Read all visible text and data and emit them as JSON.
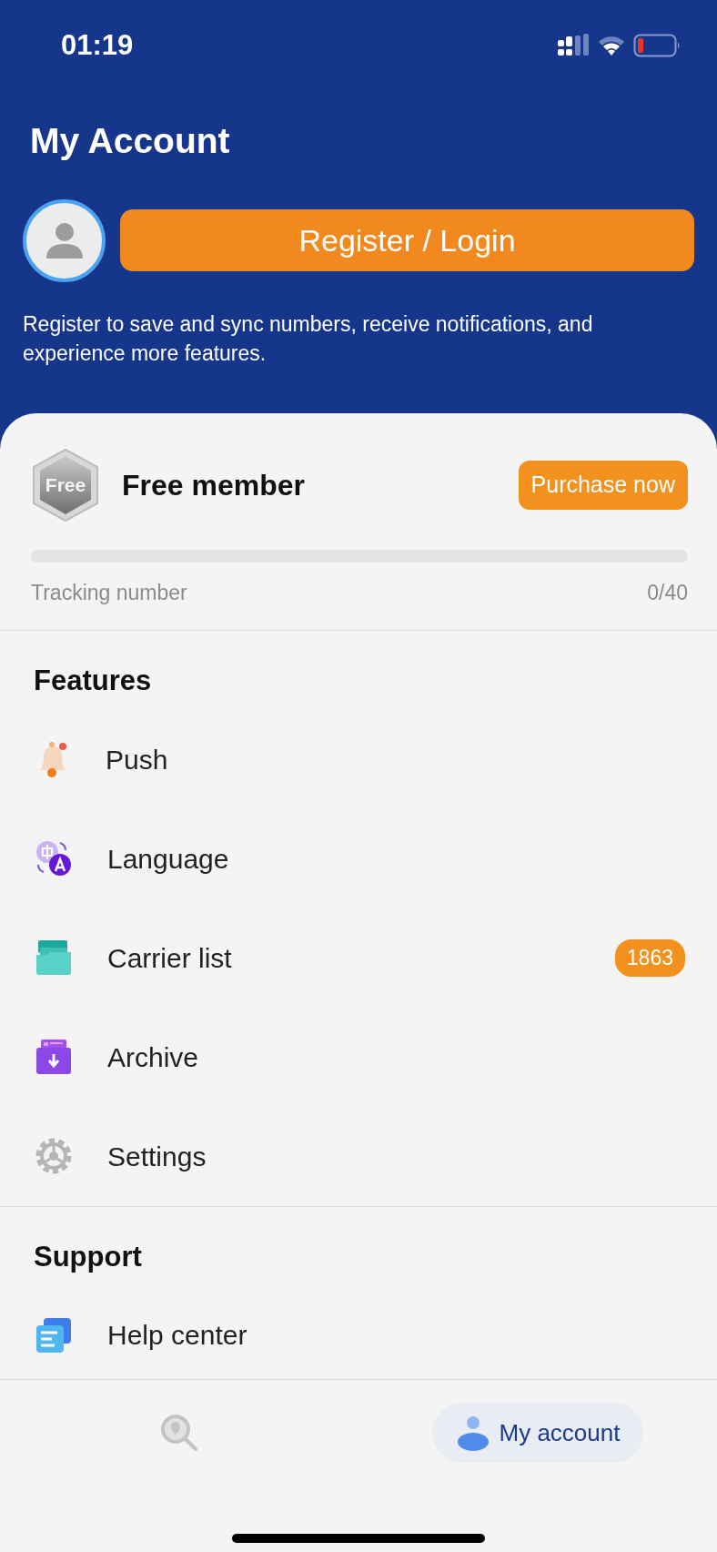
{
  "status_bar": {
    "time": "01:19"
  },
  "header": {
    "title": "My Account",
    "login_button": "Register / Login",
    "description": "Register to save and sync numbers, receive notifications, and experience more features."
  },
  "membership": {
    "badge": "Free",
    "title": "Free member",
    "purchase_button": "Purchase now",
    "progress": {
      "label": "Tracking number",
      "reading": "0/40",
      "level": 0
    }
  },
  "sections": [
    {
      "title": "Features",
      "items": [
        {
          "kind": "push",
          "label": "Push"
        },
        {
          "kind": "language",
          "label": "Language"
        },
        {
          "kind": "carrier",
          "label": "Carrier list",
          "badge": "1863"
        },
        {
          "kind": "archive",
          "label": "Archive"
        },
        {
          "kind": "settings",
          "label": "Settings"
        }
      ]
    },
    {
      "title": "Support",
      "items": [
        {
          "kind": "help",
          "label": "Help center"
        }
      ]
    }
  ],
  "tab_bar": [
    {
      "kind": "search",
      "selected": false
    },
    {
      "kind": "account",
      "label": "My account",
      "selected": true
    }
  ]
}
